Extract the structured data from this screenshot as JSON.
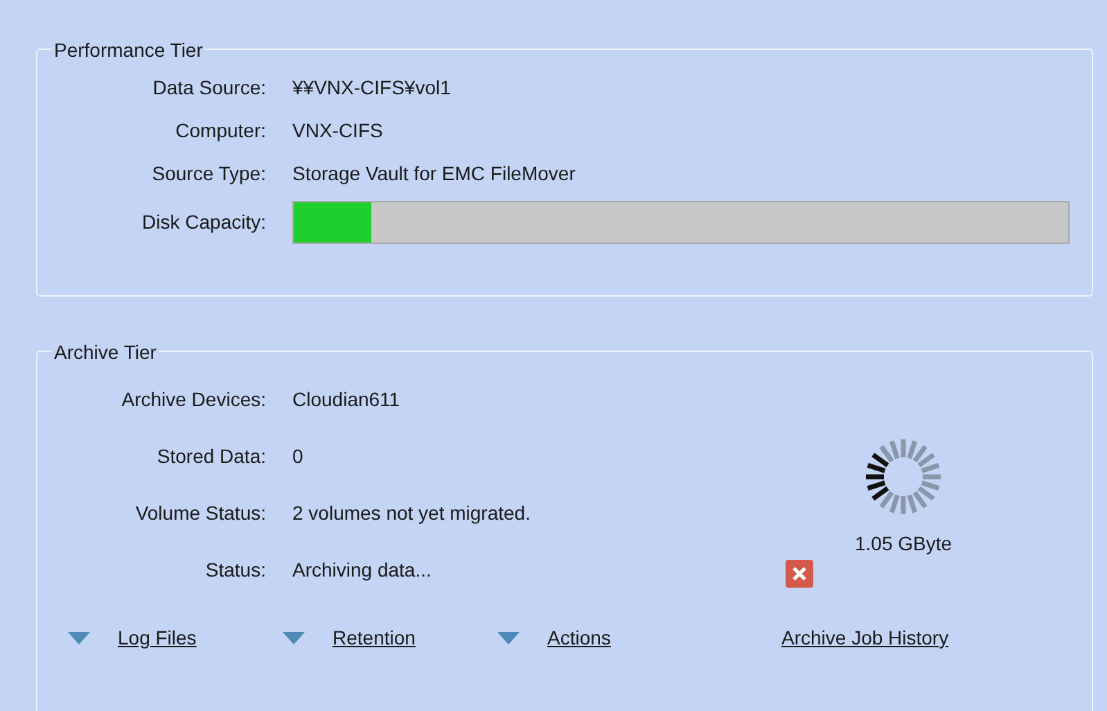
{
  "performance_tier": {
    "title": "Performance Tier",
    "fields": [
      {
        "label": "Data Source:",
        "value": "¥¥VNX-CIFS¥vol1"
      },
      {
        "label": "Computer:",
        "value": "VNX-CIFS"
      },
      {
        "label": "Source Type:",
        "value": "Storage Vault for EMC FileMover"
      }
    ],
    "disk_capacity": {
      "label": "Disk Capacity:",
      "level": 0.1
    }
  },
  "archive_tier": {
    "title": "Archive Tier",
    "fields": [
      {
        "label": "Archive Devices:",
        "value": "Cloudian611"
      },
      {
        "label": "Stored Data:",
        "value": "0"
      },
      {
        "label": "Volume Status:",
        "value": "2 volumes not yet migrated."
      },
      {
        "label": "Status:",
        "value": "Archiving data..."
      }
    ],
    "size": "1.05 GByte",
    "links": [
      {
        "label": "Log Files",
        "kind": "dropdown"
      },
      {
        "label": "Retention",
        "kind": "dropdown"
      },
      {
        "label": "Actions",
        "kind": "dropdown"
      },
      {
        "label": "Archive Job History",
        "kind": "plain"
      }
    ]
  }
}
